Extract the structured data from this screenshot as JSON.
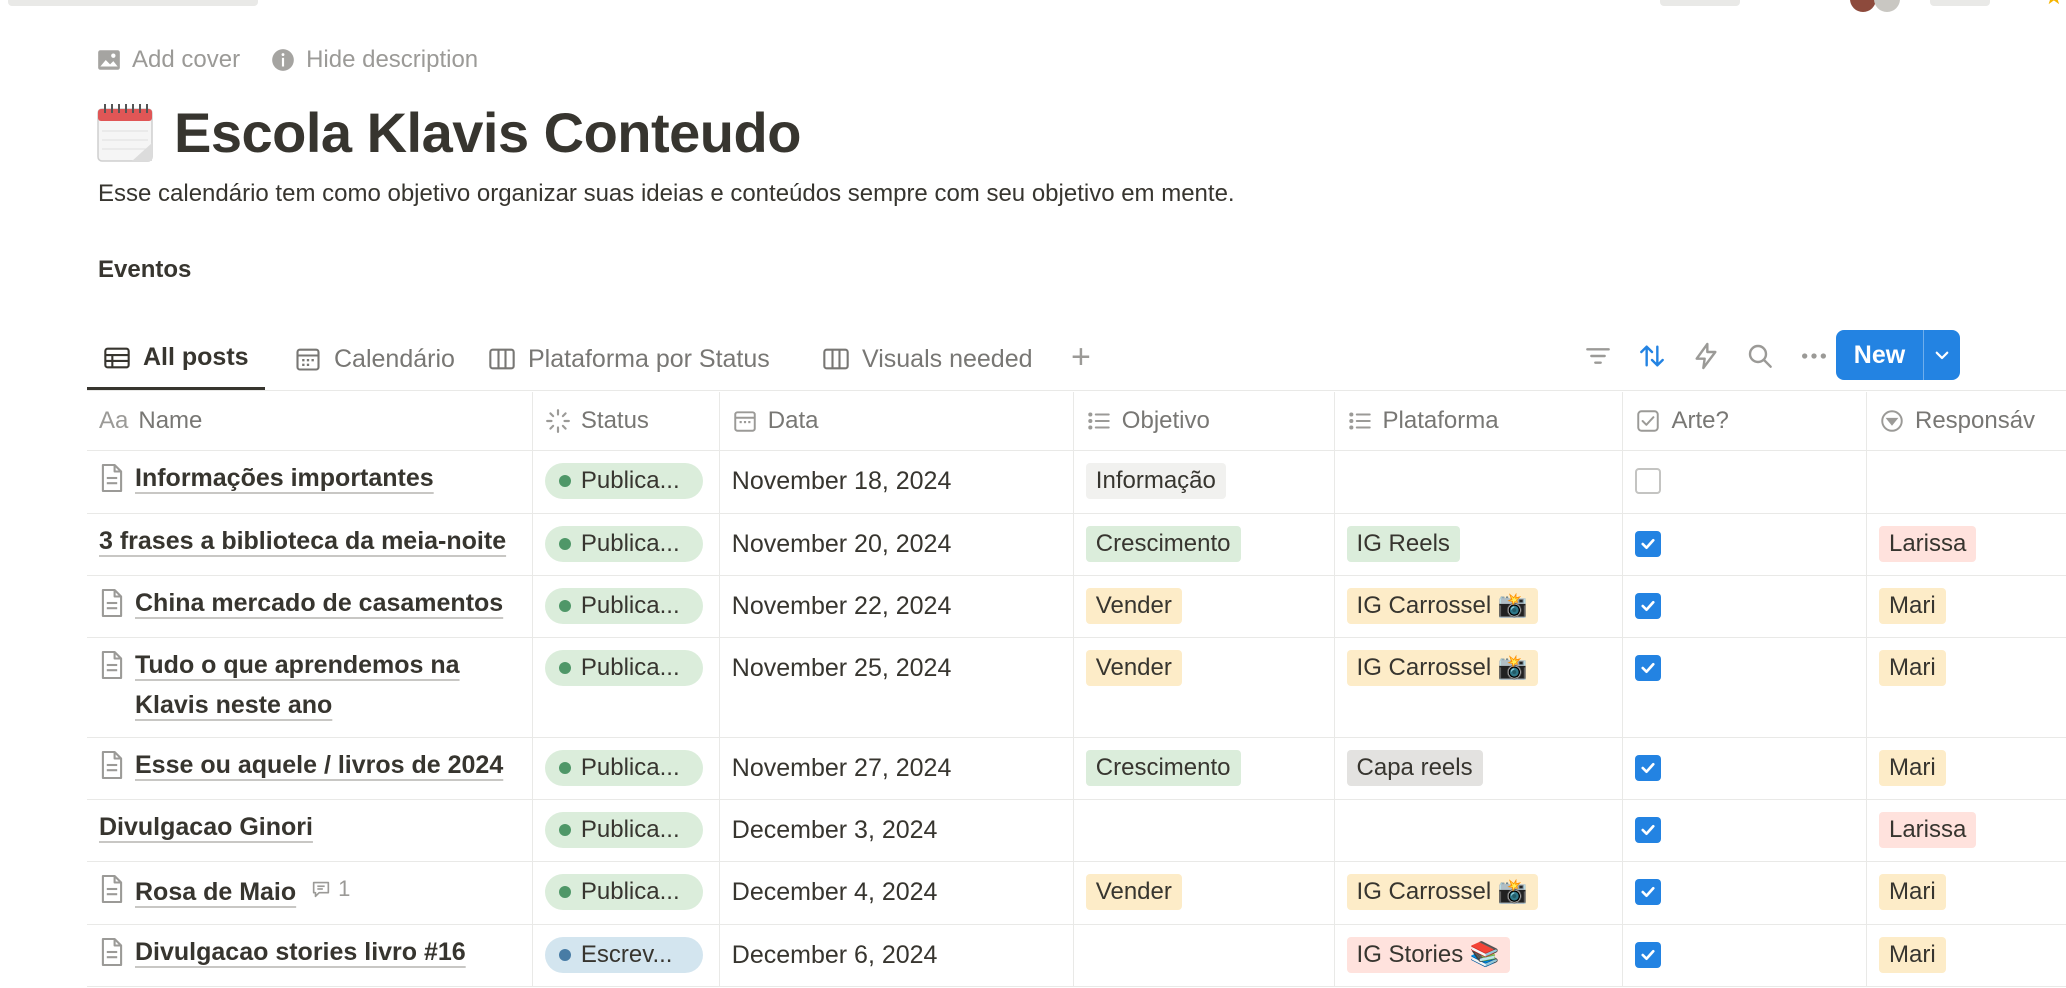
{
  "page": {
    "add_cover": "Add cover",
    "hide_description": "Hide description",
    "title": "Escola Klavis Conteudo",
    "description": "Esse calendário tem como objetivo organizar suas ideias e conteúdos sempre com seu objetivo em mente.",
    "section_heading": "Eventos"
  },
  "tabs": [
    {
      "label": "All posts",
      "icon": "table-icon",
      "active": true
    },
    {
      "label": "Calendário",
      "icon": "calendar-icon",
      "active": false
    },
    {
      "label": "Plataforma por Status",
      "icon": "board-icon",
      "active": false
    },
    {
      "label": "Visuals needed",
      "icon": "board-icon",
      "active": false
    }
  ],
  "toolbar": {
    "new_label": "New",
    "icons": [
      "filter-icon",
      "sort-icon",
      "automation-icon",
      "search-icon",
      "more-icon",
      "chevron-down-icon"
    ],
    "accent": "#2383e2"
  },
  "columns": {
    "name": "Name",
    "name_prefix": "Aa",
    "status": "Status",
    "data": "Data",
    "objetivo": "Objetivo",
    "plataforma": "Plataforma",
    "arte": "Arte?",
    "responsavel": "Responsáv"
  },
  "rows": [
    {
      "name": "Informações importantes",
      "doc_icon": true,
      "comments": "",
      "status": "Publica...",
      "status_color": "#4f9768",
      "status_bg": "#dbeddb",
      "date": "November 18, 2024",
      "objetivo": "Informação",
      "objetivo_bg": "#f1f1ef",
      "plataforma": "",
      "plataforma_bg": "",
      "arte": false,
      "responsavel": "",
      "responsavel_bg": ""
    },
    {
      "name": "3 frases a biblioteca da meia-noite",
      "doc_icon": false,
      "comments": "",
      "status": "Publica...",
      "status_color": "#4f9768",
      "status_bg": "#dbeddb",
      "date": "November 20, 2024",
      "objetivo": "Crescimento",
      "objetivo_bg": "#dbeddb",
      "plataforma": "IG Reels",
      "plataforma_bg": "#dbeddb",
      "arte": true,
      "responsavel": "Larissa",
      "responsavel_bg": "#ffe2dd"
    },
    {
      "name": "China mercado de casamentos",
      "doc_icon": true,
      "comments": "",
      "status": "Publica...",
      "status_color": "#4f9768",
      "status_bg": "#dbeddb",
      "date": "November 22, 2024",
      "objetivo": "Vender",
      "objetivo_bg": "#fdecc8",
      "plataforma": "IG Carrossel 📸",
      "plataforma_bg": "#fdecc8",
      "arte": true,
      "responsavel": "Mari",
      "responsavel_bg": "#fdecc8"
    },
    {
      "name": "Tudo o que aprendemos na Klavis neste ano",
      "doc_icon": true,
      "comments": "",
      "status": "Publica...",
      "status_color": "#4f9768",
      "status_bg": "#dbeddb",
      "date": "November 25, 2024",
      "objetivo": "Vender",
      "objetivo_bg": "#fdecc8",
      "plataforma": "IG Carrossel 📸",
      "plataforma_bg": "#fdecc8",
      "arte": true,
      "responsavel": "Mari",
      "responsavel_bg": "#fdecc8"
    },
    {
      "name": "Esse ou aquele / livros de 2024",
      "doc_icon": true,
      "comments": "",
      "status": "Publica...",
      "status_color": "#4f9768",
      "status_bg": "#dbeddb",
      "date": "November 27, 2024",
      "objetivo": "Crescimento",
      "objetivo_bg": "#dbeddb",
      "plataforma": "Capa reels",
      "plataforma_bg": "#e3e2e0",
      "arte": true,
      "responsavel": "Mari",
      "responsavel_bg": "#fdecc8"
    },
    {
      "name": "Divulgacao Ginori",
      "doc_icon": false,
      "comments": "",
      "status": "Publica...",
      "status_color": "#4f9768",
      "status_bg": "#dbeddb",
      "date": "December 3, 2024",
      "objetivo": "",
      "objetivo_bg": "",
      "plataforma": "",
      "plataforma_bg": "",
      "arte": true,
      "responsavel": "Larissa",
      "responsavel_bg": "#ffe2dd"
    },
    {
      "name": "Rosa de Maio",
      "doc_icon": true,
      "comments": "1",
      "status": "Publica...",
      "status_color": "#4f9768",
      "status_bg": "#dbeddb",
      "date": "December 4, 2024",
      "objetivo": "Vender",
      "objetivo_bg": "#fdecc8",
      "plataforma": "IG Carrossel 📸",
      "plataforma_bg": "#fdecc8",
      "arte": true,
      "responsavel": "Mari",
      "responsavel_bg": "#fdecc8"
    },
    {
      "name": "Divulgacao stories livro #16",
      "doc_icon": true,
      "comments": "",
      "status": "Escrev...",
      "status_color": "#487ca5",
      "status_bg": "#d3e5ef",
      "date": "December 6, 2024",
      "objetivo": "",
      "objetivo_bg": "",
      "plataforma": "IG Stories 📚",
      "plataforma_bg": "#ffe2dd",
      "arte": true,
      "responsavel": "Mari",
      "responsavel_bg": "#fdecc8"
    }
  ]
}
